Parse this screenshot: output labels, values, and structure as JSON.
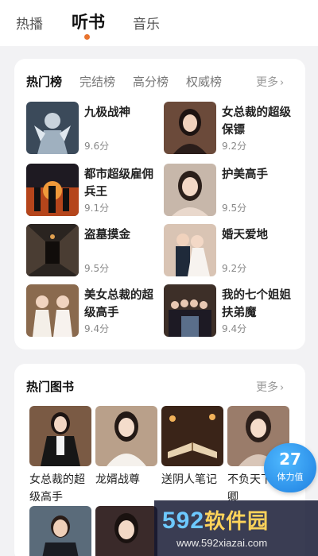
{
  "top_tabs": [
    {
      "label": "热播",
      "active": false
    },
    {
      "label": "听书",
      "active": true
    },
    {
      "label": "音乐",
      "active": false
    }
  ],
  "accent_color": "#e8732e",
  "ranking": {
    "tabs": [
      "热门榜",
      "完结榜",
      "高分榜",
      "权威榜"
    ],
    "more_label": "更多",
    "items": [
      {
        "title": "九极战神",
        "score": "9.6分",
        "cover": "armored-warrior-cover"
      },
      {
        "title": "女总裁的超级保镖",
        "score": "9.2分",
        "cover": "woman-portrait-cover"
      },
      {
        "title": "都市超级雇佣兵王",
        "score": "9.1分",
        "cover": "soldiers-fire-cover"
      },
      {
        "title": "护美高手",
        "score": "9.5分",
        "cover": "woman-portrait-cover"
      },
      {
        "title": "盗墓摸金",
        "score": "9.5分",
        "cover": "tomb-corridor-cover"
      },
      {
        "title": "婚天爱地",
        "score": "9.2分",
        "cover": "wedding-couple-cover"
      },
      {
        "title": "美女总裁的超级高手",
        "score": "9.4分",
        "cover": "two-women-cover"
      },
      {
        "title": "我的七个姐姐扶弟魔",
        "score": "9.4分",
        "cover": "family-group-cover"
      }
    ]
  },
  "hot_books": {
    "title": "热门图书",
    "more_label": "更多",
    "items": [
      {
        "title": "女总裁的超级高手",
        "cover": "woman-suit-cover"
      },
      {
        "title": "龙婿战尊",
        "cover": "woman-portrait-cover"
      },
      {
        "title": "送阴人笔记",
        "cover": "open-book-cover"
      },
      {
        "title": "不负天下负卿",
        "cover": "woman-portrait-cover"
      },
      {
        "title": "",
        "cover": "man-suit-cover"
      },
      {
        "title": "",
        "cover": "woman-portrait-cover"
      }
    ]
  },
  "stamina_badge": {
    "value": "27",
    "label": "体力值"
  },
  "watermark": {
    "brand_num": "592",
    "brand_text": "软件园",
    "url": "www.592xiazai.com"
  }
}
